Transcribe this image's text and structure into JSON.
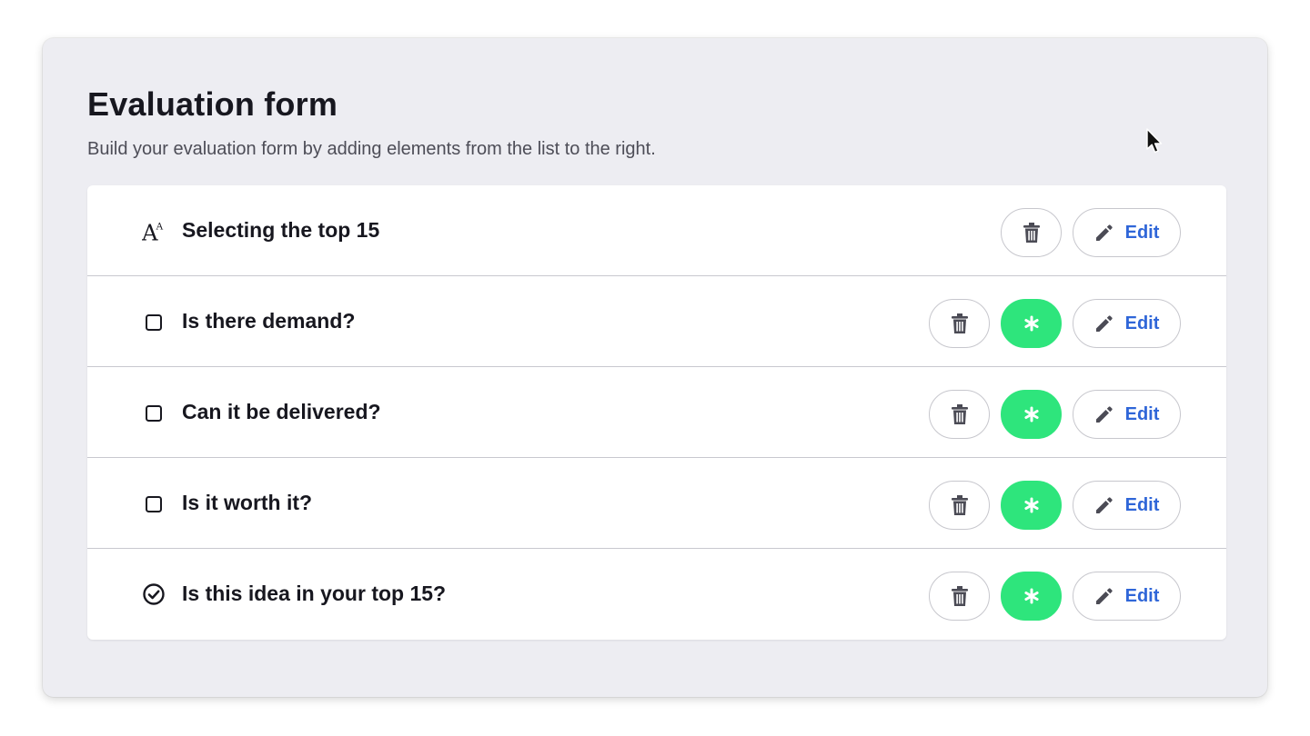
{
  "header": {
    "title": "Evaluation form",
    "subtitle": "Build your evaluation form by adding elements from the list to the right."
  },
  "colors": {
    "panel_background": "#ededf2",
    "required_green": "#2ee57c",
    "edit_blue": "#2f66d8",
    "text_dark": "#17171f"
  },
  "form": {
    "rows": [
      {
        "label": "Selecting the top 15",
        "type": "text-heading",
        "icon": "text-size-icon",
        "edit_label": "Edit",
        "has_required_toggle": false
      },
      {
        "label": "Is there demand?",
        "type": "checkbox",
        "icon": "checkbox-icon",
        "edit_label": "Edit",
        "has_required_toggle": true
      },
      {
        "label": "Can it be delivered?",
        "type": "checkbox",
        "icon": "checkbox-icon",
        "edit_label": "Edit",
        "has_required_toggle": true
      },
      {
        "label": "Is it worth it?",
        "type": "checkbox",
        "icon": "checkbox-icon",
        "edit_label": "Edit",
        "has_required_toggle": true
      },
      {
        "label": "Is this idea in your top 15?",
        "type": "yes-no",
        "icon": "check-circle-icon",
        "edit_label": "Edit",
        "has_required_toggle": true
      }
    ]
  }
}
